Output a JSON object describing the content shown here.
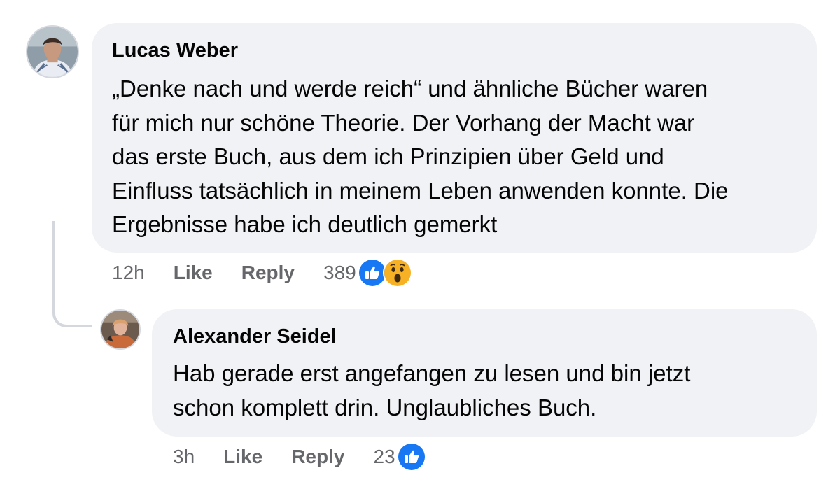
{
  "comments": [
    {
      "author": "Lucas Weber",
      "text_lines": [
        "„Denke nach und werde reich“ und ähnliche Bücher waren",
        "für mich nur schöne Theorie. Der Vorhang der Macht war",
        "das erste Buch, aus dem ich Prinzipien über Geld und",
        "Einfluss tatsächlich in meinem Leben anwenden konnte. Die",
        "Ergebnisse habe ich deutlich gemerkt"
      ],
      "time": "12h",
      "like_label": "Like",
      "reply_label": "Reply",
      "reaction_count": "389",
      "reactions": [
        "like-icon",
        "wow-icon"
      ]
    },
    {
      "author": "Alexander Seidel",
      "text_lines": [
        "Hab gerade erst angefangen zu lesen und bin jetzt",
        "schon komplett drin. Unglaubliches Buch."
      ],
      "time": "3h",
      "like_label": "Like",
      "reply_label": "Reply",
      "reaction_count": "23",
      "reactions": [
        "like-icon"
      ]
    }
  ],
  "colors": {
    "bubble_bg": "#f0f2f5",
    "meta_text": "#65676b",
    "like_blue": "#1877f2",
    "wow_yellow": "#f7b125",
    "thread_line": "#d4d8de"
  }
}
